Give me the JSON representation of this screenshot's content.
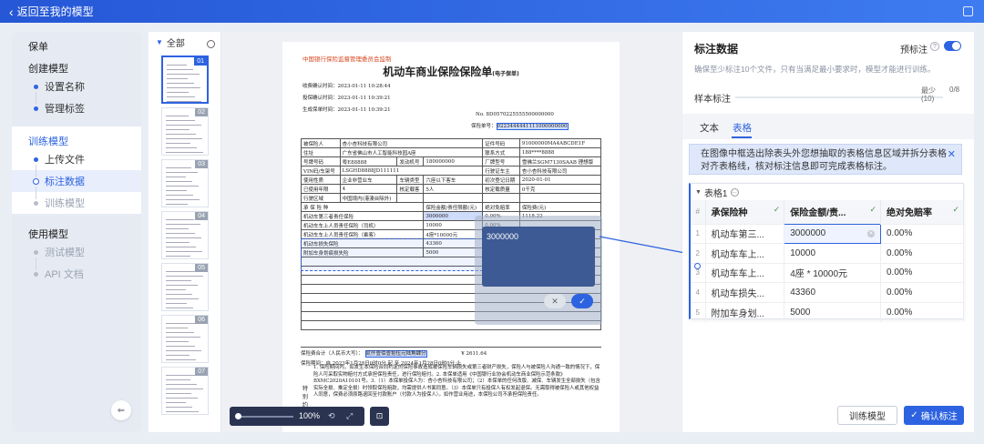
{
  "topbar": {
    "back_label": "返回至我的模型"
  },
  "nav": {
    "group_save": "保单",
    "group_create": "创建模型",
    "create_items": [
      "设置名称",
      "管理标签"
    ],
    "group_train": "训练模型",
    "train_items": [
      "上传文件",
      "标注数据",
      "训练模型"
    ],
    "group_use": "使用模型",
    "use_items": [
      "测试模型",
      "API 文档"
    ]
  },
  "thumbs": {
    "all_label": "全部",
    "pages": [
      "01",
      "02",
      "03",
      "04",
      "05",
      "06",
      "07"
    ]
  },
  "document": {
    "org": "中国银行保险监督管理委员会监制",
    "title": "机动车商业保险保险单",
    "title_suffix": "(电子保单)",
    "receipt_time": "收费确认时间：2023-01-11 10:28:44",
    "confirm_time": "投保确认时间：2023-01-11 10:39:21",
    "gen_time": "生成保单时间：2023-01-11 10:39:21",
    "no_label": "No.",
    "no_value": "8D0570225555500000000",
    "policy_label": "保险单号：",
    "policy_value": "0223444441111000000000",
    "rows": [
      [
        "被保险人",
        "杏小杏科技有限公司",
        "证件号码",
        "91000000MA4ABCDE1F"
      ],
      [
        "住址",
        "广东省佛山市人工智能科技园A座",
        "联系方式",
        "188****8888"
      ],
      [
        "号牌号码",
        "粤E88888",
        "发动机号",
        "180000000",
        "厂牌型号",
        "雪佛兰SGM7130SAAB 理想版"
      ],
      [
        "VIN码/车架号",
        "LSGHD8888JD111111",
        "行驶证车主",
        "杏小杏科技有限公司"
      ],
      [
        "使用性质",
        "企业非营业车",
        "车辆类型",
        "六座以下客车",
        "初次登记日期",
        "2020-01-01"
      ],
      [
        "已使用年限",
        "4",
        "核定载客",
        "5人",
        "核定载质量",
        "0千克"
      ],
      [
        "行驶区域",
        "中国境内(港澳台除外)",
        "",
        "",
        "",
        ""
      ]
    ],
    "coverage_header": [
      "承 保 险 种",
      "保险金额/责任限额(元)",
      "绝对免赔率",
      "保险费(元)"
    ],
    "coverages": [
      [
        "机动车第三者责任保险",
        "3000000",
        "0.00%",
        "1118.22"
      ],
      [
        "机动车车上人员责任保险（司机）",
        "10000",
        "0.00%",
        ""
      ],
      [
        "机动车车上人员责任保险（乘客）",
        "4座*10000元",
        "0.00%",
        ""
      ],
      [
        "机动车损失保险",
        "43360",
        "0.00%",
        ""
      ],
      [
        "附加车身划痕损失险",
        "5000",
        "0.00%",
        ""
      ]
    ],
    "premium_label": "保险费合计（人民币大写）：",
    "premium_cn": "贰仟壹佰壹拾伍元陆角肆分",
    "premium_amount": "2611.64",
    "period": "保险期间：自 2023年1月28日0时0分 起 至 2024年1月28日0时0分 止",
    "special_label": "特别约定",
    "special_text": "1. 保险期间内，如发生本保险合同约定的保险事故造成被保险车辆损失或第三者财产损失，保险人与被保险人沟通一致的情况下，保险人可采取实物赔付方式承担保险责任，进行保险赔付。2. 本保单适用《中国银行业协会机动车商业保险示范条款》BXMC2020A10101号。3.（1）本保单投保人为：杏小杏科技有限公司；（2）本保单的任何改版、减保、车辆发生全部损失（包含实际全损、推定全损）时领取保险赔款，均需提供人书面同意。（3）本保单只有投保人有权发起退保。无需取得被保险人或其他权益人同意，保费必须原路退回至付款账户（付款人为投保人）。如作营业用途，本保险公司不承担保险责任。"
  },
  "popup": {
    "value": "3000000",
    "cancel": "✕",
    "ok": "✓"
  },
  "zoom": {
    "percent": "100%"
  },
  "panel": {
    "title": "标注数据",
    "pre_label": "预标注",
    "pre_on": true,
    "hint": "确保至少标注10个文件，只有当满足最小要求时，模型才能进行训练。",
    "sample_label": "样本标注",
    "min_label": "最少",
    "min_count": "(10)",
    "progress": "0/8",
    "progress_fraction": 0,
    "tabs": [
      "文本",
      "表格"
    ],
    "notice": "在图像中框选出除表头外您想抽取的表格信息区域并拆分表格对齐表格线，核对标注信息即可完成表格标注。",
    "table_name": "表格1",
    "columns": [
      "承保险种",
      "保险金额/责...",
      "绝对免赔率"
    ],
    "rows": [
      [
        "1",
        "机动车第三...",
        "3000000",
        "0.00%"
      ],
      [
        "2",
        "机动车车上...",
        "10000",
        "0.00%"
      ],
      [
        "3",
        "机动车车上...",
        "4座 * 10000元",
        "0.00%"
      ],
      [
        "4",
        "机动车损失...",
        "43360",
        "0.00%"
      ],
      [
        "5",
        "附加车身划...",
        "5000",
        "0.00%"
      ]
    ],
    "train_button": "训练模型",
    "confirm_button": "确认标注"
  },
  "colors": {
    "accent": "#2d63e0",
    "topbar": "#2557d6"
  }
}
